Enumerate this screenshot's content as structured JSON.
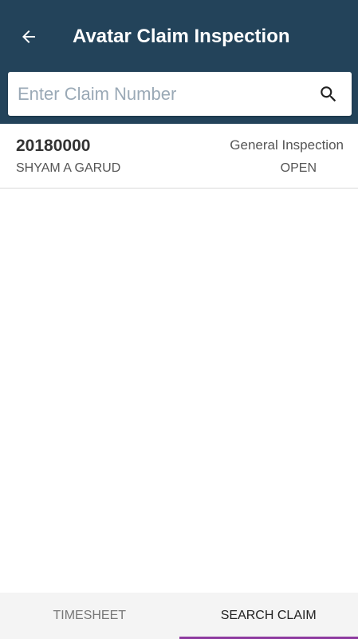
{
  "header": {
    "title": "Avatar Claim Inspection",
    "back_icon": "arrow-left-icon",
    "background_color": "#23435a"
  },
  "search": {
    "placeholder": "Enter Claim Number",
    "value": "",
    "icon": "search-icon"
  },
  "claims": [
    {
      "number": "20180000",
      "name": "SHYAM A GARUD",
      "type": "General Inspection",
      "status": "OPEN"
    }
  ],
  "bottom_nav": {
    "tabs": [
      {
        "label": "TIMESHEET",
        "active": false
      },
      {
        "label": "SEARCH CLAIM",
        "active": true
      }
    ],
    "active_indicator_color": "#8e3aa0"
  }
}
